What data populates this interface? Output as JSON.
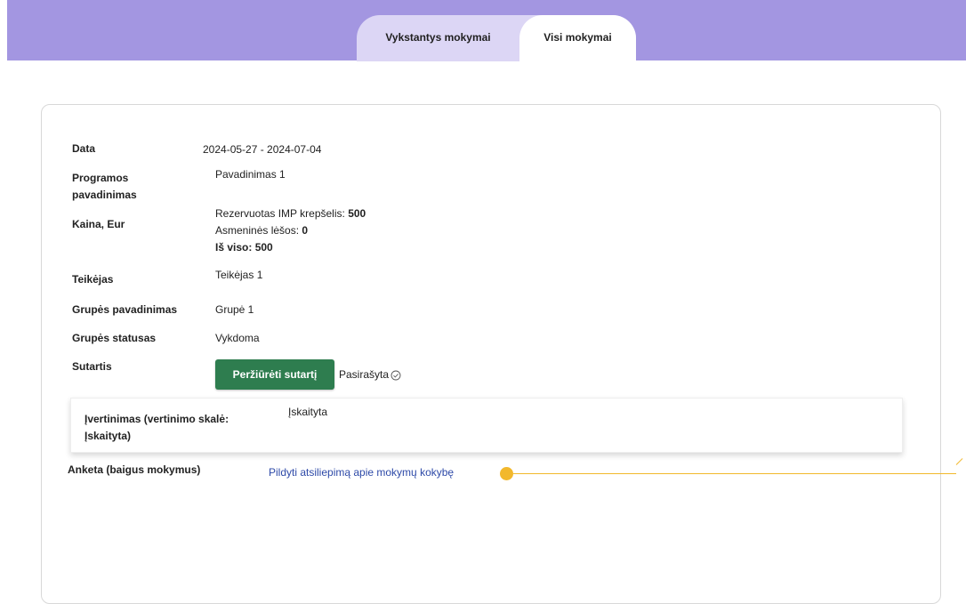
{
  "tabs": {
    "ongoing": "Vykstantys mokymai",
    "all": "Visi mokymai"
  },
  "details": {
    "date_label": "Data",
    "date_value": "2024-05-27 - 2024-07-04",
    "program_label_line1": "Programos",
    "program_label_line2": "pavadinimas",
    "program_value": "Pavadinimas 1",
    "price_label": "Kaina, Eur",
    "price_reserved_label": "Rezervuotas IMP krepšelis:",
    "price_reserved_value": "500",
    "price_personal_label": "Asmeninės lėšos:",
    "price_personal_value": "0",
    "price_total_label": "Iš viso:",
    "price_total_value": "500",
    "provider_label": "Teikėjas",
    "provider_value": "Teikėjas 1",
    "group_name_label": "Grupės pavadinimas",
    "group_name_value": "Grupė 1",
    "group_status_label": "Grupės statusas",
    "group_status_value": "Vykdoma",
    "contract_label": "Sutartis",
    "contract_button": "Peržiūrėti sutartį",
    "contract_status": "Pasirašyta",
    "evaluation_label_line1": "Įvertinimas (vertinimo skalė:",
    "evaluation_label_line2": "Įskaityta)",
    "evaluation_value": "Įskaityta",
    "survey_label": "Anketa (baigus mokymus)",
    "survey_link": "Pildyti atsiliepimą apie mokymų kokybę"
  },
  "colors": {
    "topbar": "#a396e1",
    "tab_container": "#dcd6f5",
    "button_green": "#2e7d4f",
    "link_blue": "#2e4aa8",
    "annotation_yellow": "#f2b82c"
  },
  "icons": {
    "contract_status_icon": "check-circle-icon"
  }
}
